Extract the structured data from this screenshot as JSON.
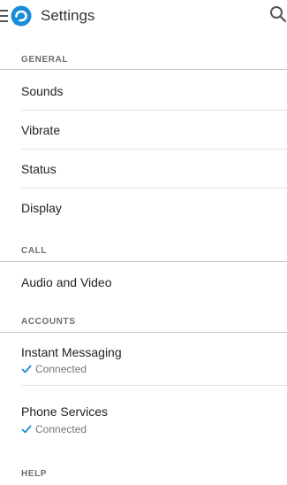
{
  "header": {
    "title": "Settings",
    "menu_icon": "hamburger-menu-icon",
    "logo_icon": "app-logo-icon",
    "search_icon": "search-icon",
    "accent_color": "#1a8cd8"
  },
  "sections": {
    "general": {
      "title": "GENERAL",
      "items": [
        "Sounds",
        "Vibrate",
        "Status",
        "Display"
      ]
    },
    "call": {
      "title": "CALL",
      "items": [
        "Audio and Video"
      ]
    },
    "accounts": {
      "title": "ACCOUNTS",
      "items": [
        {
          "label": "Instant Messaging",
          "status": "Connected"
        },
        {
          "label": "Phone Services",
          "status": "Connected"
        }
      ]
    },
    "help": {
      "title": "HELP"
    }
  },
  "colors": {
    "check": "#1a8cd8"
  }
}
